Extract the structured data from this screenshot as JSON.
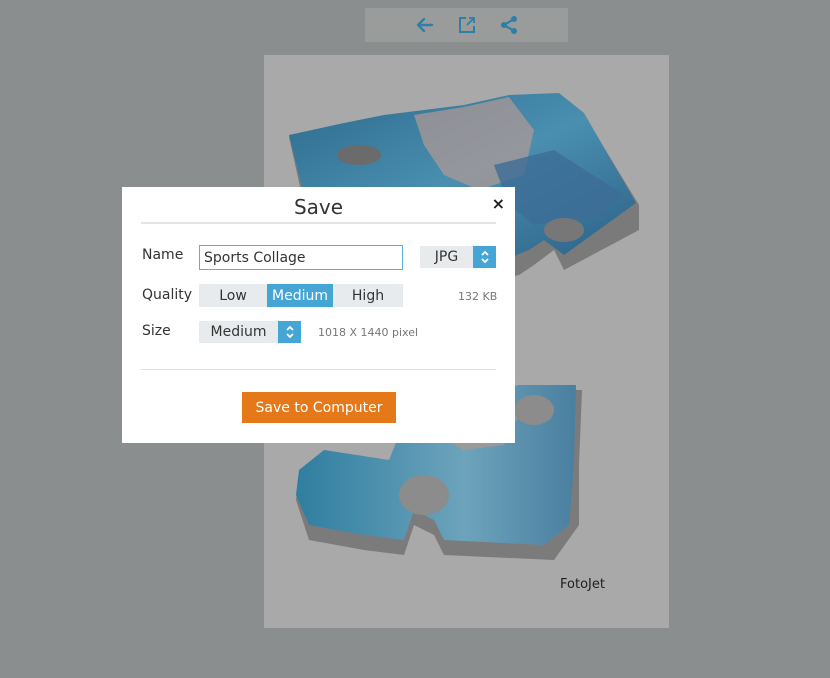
{
  "toolbar": {
    "buttons": [
      {
        "icon": "arrow-left-icon",
        "action": "back"
      },
      {
        "icon": "open-external-icon",
        "action": "open"
      },
      {
        "icon": "share-icon",
        "action": "share"
      }
    ],
    "icon_color": "#2e7fa6"
  },
  "canvas": {
    "watermark": "FotoJet"
  },
  "dialog": {
    "title": "Save",
    "close_label": "×",
    "name": {
      "label": "Name",
      "value": "Sports Collage"
    },
    "format": {
      "selected": "JPG"
    },
    "quality": {
      "label": "Quality",
      "options": [
        "Low",
        "Medium",
        "High"
      ],
      "selected": "Medium",
      "file_size": "132 KB"
    },
    "size": {
      "label": "Size",
      "selected": "Medium",
      "dimensions": "1018 X 1440 pixel"
    },
    "save_button": "Save to Computer"
  },
  "colors": {
    "accent": "#45a5d5",
    "primary_button": "#e57818",
    "overlay": "#8a8e8f"
  }
}
